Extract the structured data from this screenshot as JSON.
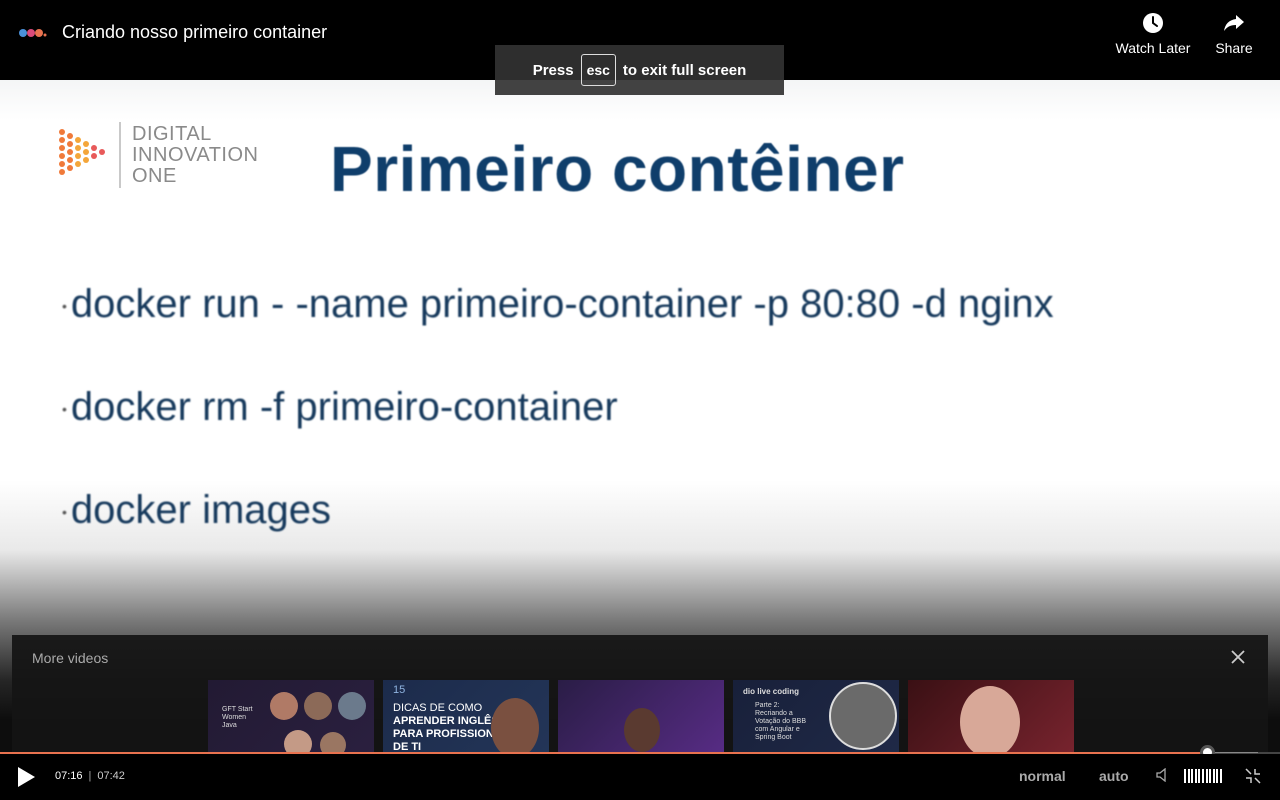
{
  "topbar": {
    "video_title": "Criando nosso primeiro container",
    "watch_later_label": "Watch Later",
    "share_label": "Share"
  },
  "fullscreen_hint": {
    "press": "Press",
    "key": "esc",
    "rest": "to exit full screen"
  },
  "slide": {
    "logo_lines": [
      "DIGITAL",
      "INNOVATION",
      "ONE"
    ],
    "title": "Primeiro contêiner",
    "bullets": [
      "docker run - -name primeiro-container -p 80:80 -d nginx",
      "docker rm -f primeiro-container",
      "docker images"
    ]
  },
  "more_videos": {
    "heading": "More videos",
    "thumbnails": [
      {
        "title": "GFT Start Women Java"
      },
      {
        "number": "15",
        "line1": "DICAS DE COMO",
        "line2": "APRENDER INGLÊS",
        "line3": "PARA PROFISSIONAIS",
        "line4": "DE TI"
      },
      {
        "title": ""
      },
      {
        "brand": "dio live coding",
        "text": "Parte 2: Recriando a Votação do BBB com Angular e Spring Boot"
      },
      {
        "title": ""
      }
    ]
  },
  "player": {
    "current_time": "07:16",
    "separator": "|",
    "duration": "07:42",
    "progress_fraction": 0.94,
    "speed_label": "normal",
    "quality_label": "auto",
    "accent_color": "#e8724f"
  }
}
